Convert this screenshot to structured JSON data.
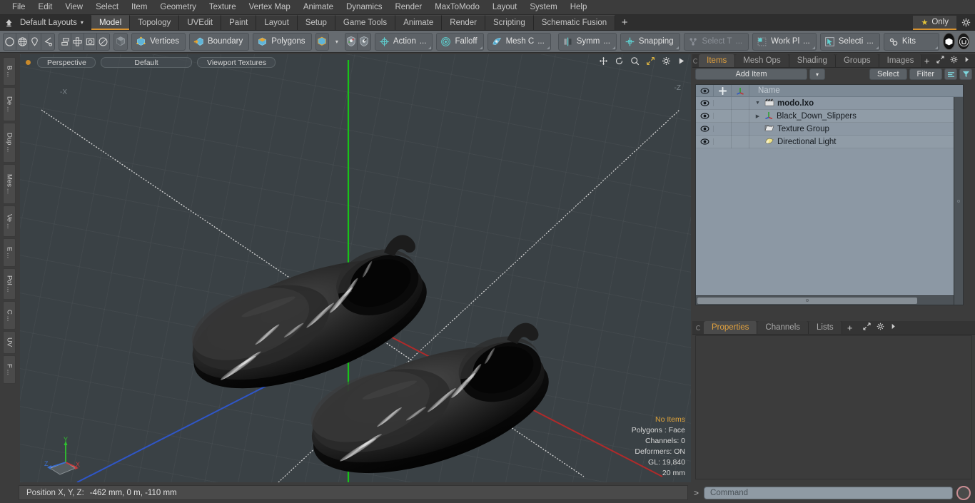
{
  "app": {
    "title": "Modo"
  },
  "menubar": {
    "items": [
      "File",
      "Edit",
      "View",
      "Select",
      "Item",
      "Geometry",
      "Texture",
      "Vertex Map",
      "Animate",
      "Dynamics",
      "Render",
      "MaxToModo",
      "Layout",
      "System",
      "Help"
    ]
  },
  "layoutbar": {
    "home_icon": "home-icon",
    "layouts_label": "Default Layouts",
    "caret": "▾",
    "tabs": [
      {
        "label": "Model",
        "active": true
      },
      {
        "label": "Topology",
        "active": false
      },
      {
        "label": "UVEdit",
        "active": false
      },
      {
        "label": "Paint",
        "active": false
      },
      {
        "label": "Layout",
        "active": false
      },
      {
        "label": "Setup",
        "active": false
      },
      {
        "label": "Game Tools",
        "active": false
      },
      {
        "label": "Animate",
        "active": false
      },
      {
        "label": "Render",
        "active": false
      },
      {
        "label": "Scripting",
        "active": false
      },
      {
        "label": "Schematic Fusion",
        "active": false
      }
    ],
    "add_tab": "+",
    "only_label": "Only",
    "only_star": "★",
    "gear": "⚙",
    "accent": "#d9932f"
  },
  "toolbar": {
    "primitives": [
      "circle-icon",
      "globe-icon",
      "pen-icon",
      "curve-icon"
    ],
    "arrange": [
      "align-icon",
      "center-icon",
      "square-target-icon",
      "circle-target-icon"
    ],
    "cube_solo": "cube-icon",
    "selection_modes": [
      {
        "label": "Vertices",
        "icon": "vertices-cube-icon"
      },
      {
        "label": "Boundary",
        "icon": "boundary-cube-icon"
      },
      {
        "label": "Polygons",
        "icon": "polygons-cube-icon"
      }
    ],
    "mode_cube": "cube-icon",
    "mode_caret": "▾",
    "shield_icons": [
      "shield-a-icon",
      "shield-b-icon"
    ],
    "tools": [
      {
        "label": "Action",
        "suffix": "...",
        "icon": "action-center-icon",
        "dim": false
      },
      {
        "label": "Falloff",
        "suffix": "",
        "icon": "falloff-icon",
        "dim": false
      },
      {
        "label": "Mesh C",
        "suffix": "...",
        "icon": "mesh-constraint-icon",
        "dim": false
      }
    ],
    "symmetry": {
      "label": "Symm",
      "suffix": "...",
      "icon": "symmetry-icon"
    },
    "snapping": {
      "label": "Snapping",
      "icon": "snapping-icon"
    },
    "select_through": {
      "label": "Select T",
      "suffix": "...",
      "icon": "select-through-icon",
      "dim": true
    },
    "work_plane": {
      "label": "Work Pl",
      "suffix": "...",
      "icon": "work-plane-icon"
    },
    "selection_set": {
      "label": "Selecti",
      "suffix": "...",
      "icon": "selection-arrow-icon"
    },
    "kits": {
      "label": "Kits",
      "icon": "kits-gear-icon"
    },
    "badges": [
      "modo-badge-icon",
      "unreal-badge-icon"
    ]
  },
  "left_strip": {
    "tabs": [
      "B ...",
      "De ...",
      "Dup ...",
      "Mes ...",
      "Ve ...",
      "E ...",
      "Pol ...",
      "C ...",
      "UV",
      "F ..."
    ]
  },
  "viewport": {
    "pills": [
      "Perspective",
      "Default",
      "Viewport Textures"
    ],
    "tool_icons": [
      "move-icon",
      "rotate-icon",
      "zoom-icon",
      "fit-icon",
      "gear-icon",
      "play-icon"
    ],
    "corner_labels": {
      "top_left": "-X",
      "top_right": "-Z"
    },
    "stats": {
      "selection": "No Items",
      "polygons": "Polygons : Face",
      "channels": "Channels: 0",
      "deformers": "Deformers: ON",
      "gl": "GL: 19,840",
      "scale": "20 mm"
    },
    "axis_gizmo": {
      "x": "X",
      "y": "Y",
      "z": "Z",
      "x_color": "#c43c3c",
      "y_color": "#2fc22f",
      "z_color": "#3c6fd0"
    },
    "background": "#3a4145"
  },
  "right_panel": {
    "tabs": [
      {
        "label": "Items",
        "active": true
      },
      {
        "label": "Mesh Ops",
        "active": false
      },
      {
        "label": "Shading",
        "active": false
      },
      {
        "label": "Groups",
        "active": false
      },
      {
        "label": "Images",
        "active": false
      }
    ],
    "add_tab": "+",
    "ctrl_icons": [
      "expand-icon",
      "gear-icon",
      "chevron-right-icon"
    ],
    "add_item_label": "Add Item",
    "add_item_caret": "▾",
    "select_label": "Select",
    "filter_label": "Filter",
    "list_icon": "list-options-icon",
    "funnel_icon": "funnel-icon",
    "tree": {
      "columns": [
        "eye-icon",
        "lock-icon",
        "axis-icon"
      ],
      "name_header": "Name",
      "rows": [
        {
          "label": "modo.lxo",
          "icon": "scene-clapper-icon",
          "indent": 0,
          "twisty": "▼",
          "root": true
        },
        {
          "label": "Black_Down_Slippers",
          "icon": "mesh-axis-icon",
          "indent": 1,
          "twisty": "▶",
          "root": false
        },
        {
          "label": "Texture Group",
          "icon": "folder-icon",
          "indent": 1,
          "twisty": "",
          "root": false
        },
        {
          "label": "Directional Light",
          "icon": "light-icon",
          "indent": 1,
          "twisty": "",
          "root": false
        }
      ],
      "background": "#8c98a4"
    },
    "properties_tabs": [
      {
        "label": "Properties",
        "active": true
      },
      {
        "label": "Channels",
        "active": false
      },
      {
        "label": "Lists",
        "active": false
      }
    ],
    "properties_add": "+"
  },
  "bottom": {
    "status_label": "Position X, Y, Z:",
    "status_value": "-462 mm, 0 m, -110 mm",
    "command_prompt": ">",
    "command_placeholder": "Command",
    "record_icon": "record-icon"
  }
}
